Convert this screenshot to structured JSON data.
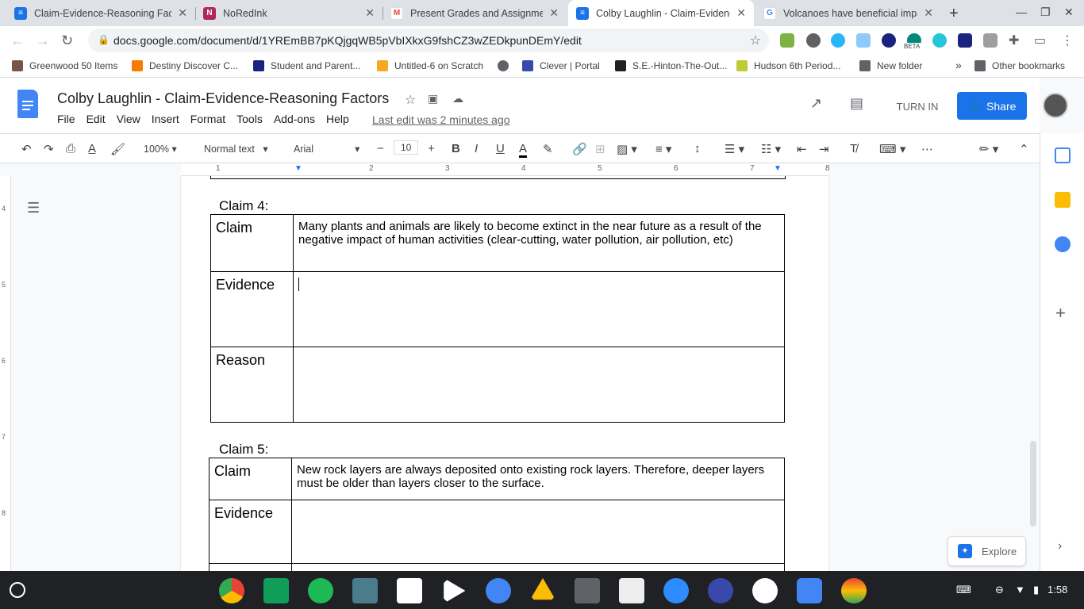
{
  "tabs": [
    {
      "title": "Claim-Evidence-Reasoning Fact",
      "favicon": "docs-icon",
      "color": "#1a73e8",
      "active": false
    },
    {
      "title": "NoRedInk",
      "favicon": "noredink-icon",
      "color": "#b0275d",
      "active": false
    },
    {
      "title": "Present Grades and Assignmen",
      "favicon": "gmail-icon",
      "color": "#ea4335",
      "active": false
    },
    {
      "title": "Colby Laughlin - Claim-Evidenc",
      "favicon": "docs-icon",
      "color": "#1a73e8",
      "active": true
    },
    {
      "title": "Volcanoes have beneficial impa",
      "favicon": "google-icon",
      "color": "#4285f4",
      "active": false
    }
  ],
  "omnibox": {
    "url": "docs.google.com/document/d/1YREmBB7pKQjgqWB5pVbIXkxG9fshCZ3wZEDkpunDEmY/edit"
  },
  "ext_badge": "BETA",
  "bookmarks": [
    {
      "label": "Greenwood 50 Items",
      "color": "#795548"
    },
    {
      "label": "Destiny Discover C...",
      "color": "#f57c00"
    },
    {
      "label": "Student and Parent...",
      "color": "#1a237e"
    },
    {
      "label": "Untitled-6 on Scratch",
      "color": "#f9a825"
    },
    {
      "label": "",
      "color": "#5f6368"
    },
    {
      "label": "Clever | Portal",
      "color": "#3949ab"
    },
    {
      "label": "S.E.-Hinton-The-Out...",
      "color": "#212121"
    },
    {
      "label": "Hudson 6th Period...",
      "color": "#c0ca33"
    },
    {
      "label": "New folder",
      "color": "#5f6368"
    }
  ],
  "bookmarks_more": "»",
  "other_bookmarks": "Other bookmarks",
  "doc": {
    "title": "Colby Laughlin - Claim-Evidence-Reasoning Factors",
    "menu": [
      "File",
      "Edit",
      "View",
      "Insert",
      "Format",
      "Tools",
      "Add-ons",
      "Help"
    ],
    "last_edit": "Last edit was 2 minutes ago",
    "turn_in": "TURN IN",
    "share": "Share"
  },
  "format": {
    "zoom": "100%",
    "style": "Normal text",
    "font": "Arial",
    "size": "10"
  },
  "ruler": {
    "h": [
      "1",
      "2",
      "3",
      "4",
      "5",
      "6",
      "7",
      "8"
    ],
    "v": [
      "4",
      "5",
      "6",
      "7",
      "8"
    ]
  },
  "claims": [
    {
      "heading": "Claim 4:",
      "rows": [
        {
          "label": "Claim",
          "text": "Many plants and animals are likely to become extinct in the near future as a result of the negative impact of human activities (clear-cutting, water pollution, air pollution, etc)"
        },
        {
          "label": "Evidence",
          "text": ""
        },
        {
          "label": "Reason",
          "text": ""
        }
      ]
    },
    {
      "heading": "Claim 5:",
      "rows": [
        {
          "label": "Claim",
          "text": "New rock layers are always deposited onto existing rock layers. Therefore, deeper layers must be older than layers closer to the surface."
        },
        {
          "label": "Evidence",
          "text": ""
        }
      ]
    }
  ],
  "explore": "Explore",
  "clock": "1:58"
}
